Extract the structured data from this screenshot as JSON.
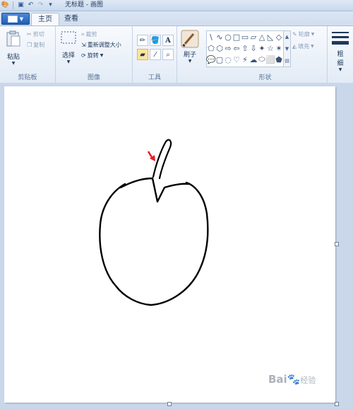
{
  "window": {
    "title": "无标题 - 画图"
  },
  "quick_access": {
    "icons": [
      "paint-app-icon",
      "save-icon",
      "undo-icon",
      "redo-icon",
      "customize-icon"
    ]
  },
  "tabs": [
    {
      "label": "主页",
      "active": true
    },
    {
      "label": "查看",
      "active": false
    }
  ],
  "ribbon": {
    "clipboard": {
      "label": "剪贴板",
      "paste": "粘贴",
      "cut": "剪切",
      "copy": "复制"
    },
    "image": {
      "label": "图像",
      "select": "选择",
      "crop": "裁剪",
      "resize": "重新调整大小",
      "rotate": "旋转"
    },
    "tools": {
      "label": "工具",
      "text_tool": "A"
    },
    "brushes": {
      "label": "刷子"
    },
    "shapes": {
      "label": "形状",
      "outline": "轮廓",
      "fill": "填充",
      "glyphs": [
        "\\",
        "∿",
        "○",
        "□",
        "▭",
        "▱",
        "△",
        "◺",
        "◇",
        "⬠",
        "⬡",
        "⇨",
        "⇦",
        "⇧",
        "⇩",
        "✦",
        "☆",
        "✶",
        "💬",
        "▢",
        "◌",
        "♡",
        "⚡",
        "☁",
        "⬭",
        "⬜",
        "⬟"
      ]
    },
    "size": {
      "label_line1": "粗",
      "label_line2": "细"
    }
  },
  "canvas": {
    "background": "#ffffff",
    "stroke_color": "#000000",
    "arrow_color": "#e41e25"
  },
  "watermark": {
    "brand": "Bai",
    "brand2": "经验"
  }
}
